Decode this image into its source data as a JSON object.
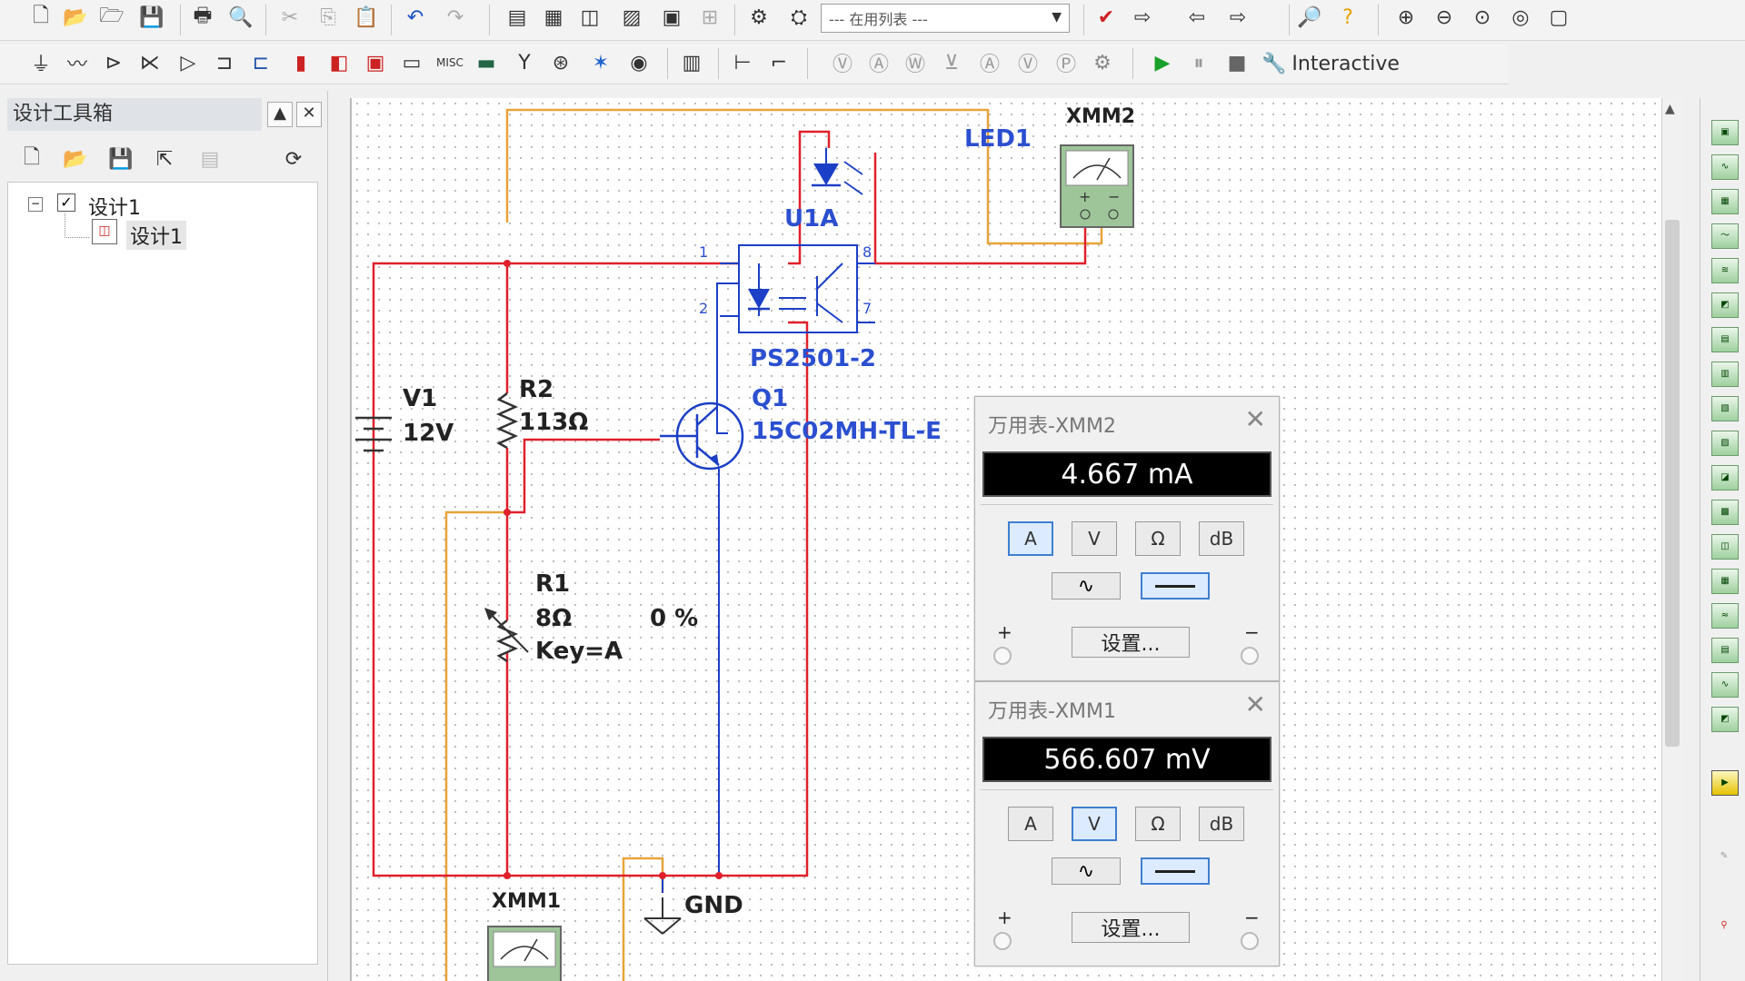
{
  "toolbar1": {
    "combo_value": "--- 在用列表 ---",
    "icons": [
      "new-icon",
      "open-icon",
      "open-folder-icon",
      "save-icon",
      "print-icon",
      "print-preview-icon",
      "cut-icon",
      "copy-icon",
      "paste-icon",
      "undo-icon",
      "redo-icon",
      "grapher-icon",
      "spreadsheet-icon",
      "breadboard-icon",
      "postprocessor-icon",
      "description-icon",
      "component-wizard-icon",
      "database-icon",
      "electrical-rules-icon",
      "show-breadboard-icon",
      "transfer-icon",
      "back-annotate-icon",
      "forward-annotate-icon",
      "search-icon",
      "help-icon",
      "zoom-in-icon",
      "zoom-out-icon",
      "zoom-area-icon",
      "zoom-sheet-icon",
      "full-screen-icon"
    ]
  },
  "toolbar2": {
    "interactive_label": "Interactive"
  },
  "left_panel": {
    "title": "设计工具箱",
    "minimize_glyph": "▲",
    "close_glyph": "✕",
    "tree": [
      {
        "label": "设计1",
        "checked": true
      },
      {
        "label": "设计1"
      }
    ]
  },
  "schematic": {
    "v1": {
      "ref": "V1",
      "value": "12V"
    },
    "r2": {
      "ref": "R2",
      "value": "113Ω"
    },
    "r1": {
      "ref": "R1",
      "value": "8Ω",
      "key": "Key=A",
      "percent": "0 %"
    },
    "q1": {
      "ref": "Q1",
      "model": "15C02MH-TL-E"
    },
    "u1": {
      "ref": "U1A",
      "model": "PS2501-2",
      "pins": [
        "1",
        "2",
        "8",
        "7"
      ]
    },
    "led": {
      "ref": "LED1"
    },
    "xmm2": {
      "ref": "XMM2"
    },
    "xmm1": {
      "ref": "XMM1"
    },
    "gnd": {
      "label": "GND"
    }
  },
  "meter_xmm2": {
    "title": "万用表-XMM2",
    "reading": "4.667 mA",
    "buttons": [
      "A",
      "V",
      "Ω",
      "dB"
    ],
    "active": "A",
    "settings": "设置...",
    "plus": "+",
    "minus": "−"
  },
  "meter_xmm1": {
    "title": "万用表-XMM1",
    "reading": "566.607 mV",
    "buttons": [
      "A",
      "V",
      "Ω",
      "dB"
    ],
    "active": "V",
    "settings": "设置...",
    "plus": "+",
    "minus": "−"
  },
  "colors": {
    "wire_red": "#e0202a",
    "wire_orange": "#e8a33a",
    "component_blue": "#1b3fc6",
    "label_blue": "#2b4fd0"
  }
}
